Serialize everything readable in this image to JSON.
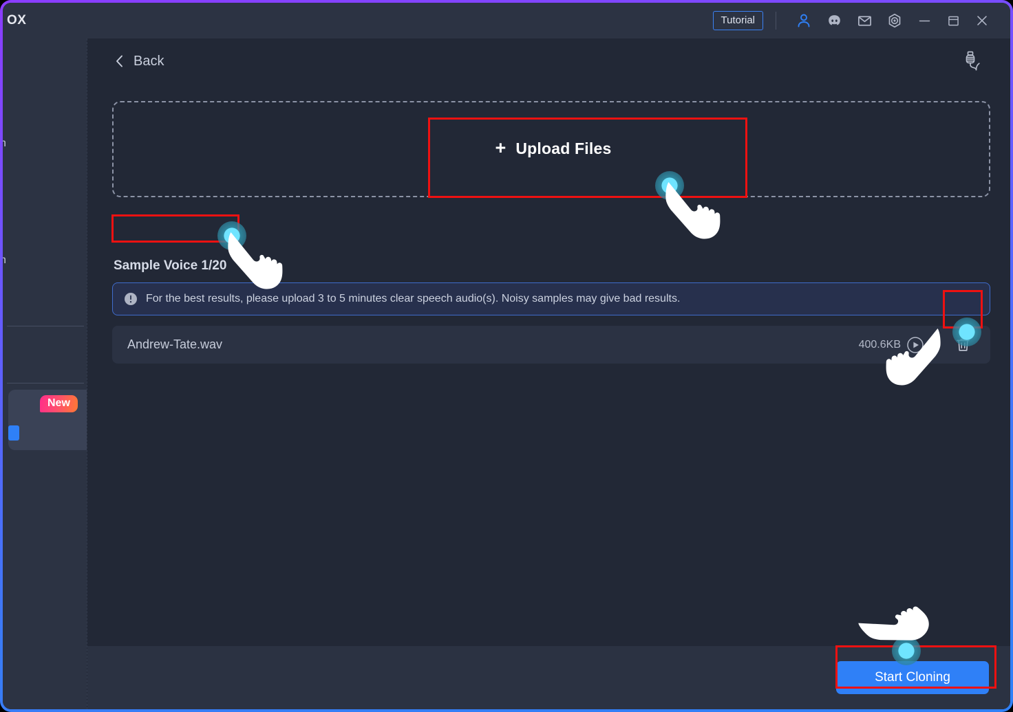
{
  "window": {
    "border_gradient_from": "#8b3dff",
    "border_gradient_to": "#2f80f7",
    "app_logo_text": "OX"
  },
  "titlebar": {
    "tutorial_label": "Tutorial",
    "icons": [
      {
        "name": "account-icon",
        "glyph": "person"
      },
      {
        "name": "discord-icon",
        "glyph": "discord"
      },
      {
        "name": "mail-icon",
        "glyph": "envelope"
      },
      {
        "name": "settings-icon",
        "glyph": "gear"
      }
    ],
    "window_controls": [
      {
        "name": "minimize-button",
        "glyph": "minus"
      },
      {
        "name": "maximize-button",
        "glyph": "square"
      },
      {
        "name": "close-button",
        "glyph": "cross"
      }
    ],
    "accent_color": "#2f80f7"
  },
  "sidebar": {
    "item_1_partial": "ch",
    "item_2_partial": "ch",
    "promo_badge": "New",
    "badge_gradient_from": "#ff2d8a",
    "badge_gradient_to": "#ff7a33"
  },
  "header": {
    "back_label": "Back",
    "mic_tool_icon": "microphone-plug-icon"
  },
  "upload": {
    "plus_symbol": "+",
    "button_label": "Upload Files"
  },
  "sample_voice": {
    "heading": "Sample Voice 1/20",
    "info_text": "For the best results, please upload 3 to 5 minutes clear speech audio(s). Noisy samples may give bad results.",
    "info_banner_border": "#3f6ccc"
  },
  "files": [
    {
      "name": "Andrew-Tate.wav",
      "size": "400.6KB"
    }
  ],
  "footer": {
    "start_cloning_label": "Start Cloning",
    "button_color": "#2f80f7"
  },
  "annotations": {
    "box_color": "#ee1111",
    "cursor_pulse_color": "#6fe4ff",
    "targets": [
      "Upload Files",
      "Sample Voice 1/20",
      "delete-file",
      "Start Cloning"
    ]
  }
}
